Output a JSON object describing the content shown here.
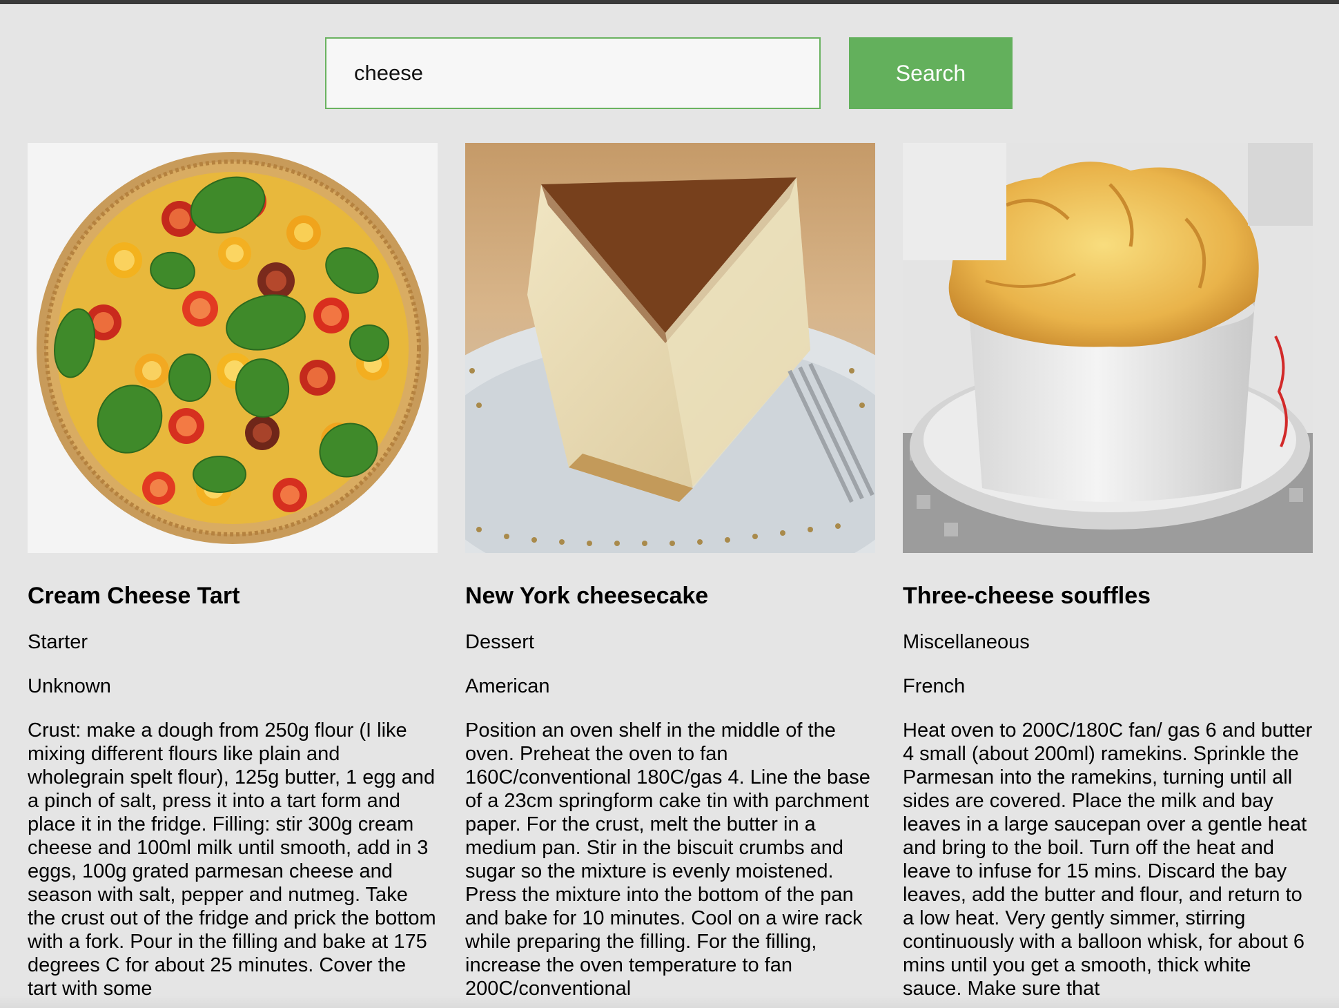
{
  "search": {
    "value": "cheese",
    "button_label": "Search"
  },
  "results": [
    {
      "title": "Cream Cheese Tart",
      "category": "Starter",
      "area": "Unknown",
      "instructions": "Crust: make a dough from 250g flour (I like mixing different flours like plain and wholegrain spelt flour), 125g butter, 1 egg and a pinch of salt, press it into a tart form and place it in the fridge. Filling: stir 300g cream cheese and 100ml milk until smooth, add in 3 eggs, 100g grated parmesan cheese and season with salt, pepper and nutmeg. Take the crust out of the fridge and prick the bottom with a fork. Pour in the filling and bake at 175 degrees C for about 25 minutes. Cover the tart with some",
      "image": "tomato-basil-tart"
    },
    {
      "title": "New York cheesecake",
      "category": "Dessert",
      "area": "American",
      "instructions": "Position an oven shelf in the middle of the oven. Preheat the oven to fan 160C/conventional 180C/gas 4. Line the base of a 23cm springform cake tin with parchment paper. For the crust, melt the butter in a medium pan. Stir in the biscuit crumbs and sugar so the mixture is evenly moistened. Press the mixture into the bottom of the pan and bake for 10 minutes. Cool on a wire rack while preparing the filling. For the filling, increase the oven temperature to fan 200C/conventional",
      "image": "cheesecake-slice"
    },
    {
      "title": "Three-cheese souffles",
      "category": "Miscellaneous",
      "area": "French",
      "instructions": "Heat oven to 200C/180C fan/ gas 6 and butter 4 small (about 200ml) ramekins. Sprinkle the Parmesan into the ramekins, turning until all sides are covered. Place the milk and bay leaves in a large saucepan over a gentle heat and bring to the boil. Turn off the heat and leave to infuse for 15 mins. Discard the bay leaves, add the butter and flour, and return to a low heat. Very gently simmer, stirring continuously with a balloon whisk, for about 6 mins until you get a smooth, thick white sauce. Make sure that",
      "image": "souffle-ramekin"
    }
  ],
  "colors": {
    "accent": "#63b05c",
    "background": "#e5e5e5",
    "input_border": "#6ab260"
  }
}
